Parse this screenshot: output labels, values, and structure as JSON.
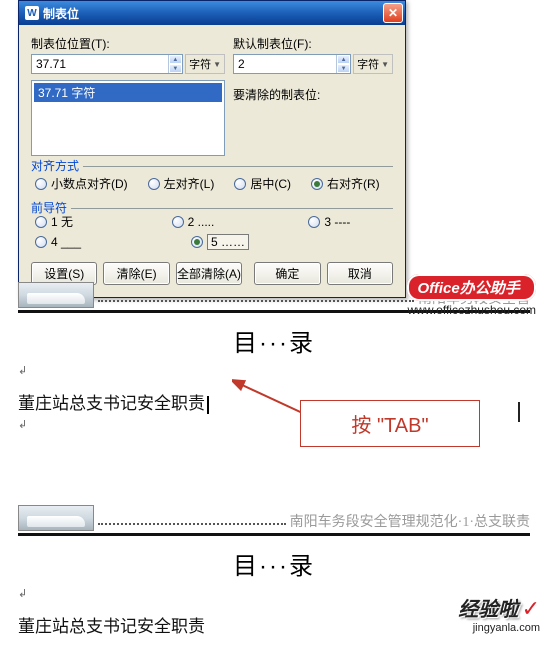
{
  "dialog": {
    "title": "制表位",
    "tab_pos_label": "制表位位置(T):",
    "tab_pos_value": "37.71",
    "unit_label": "字符",
    "default_label": "默认制表位(F):",
    "default_value": "2",
    "clear_label": "要清除的制表位:",
    "list_item": "37.71 字符",
    "align": {
      "group": "对齐方式",
      "decimal": "小数点对齐(D)",
      "left": "左对齐(L)",
      "center": "居中(C)",
      "right": "右对齐(R)",
      "selected": "right"
    },
    "leader": {
      "group": "前导符",
      "r1": "1 无",
      "r2": "2 .....",
      "r3": "3 ----",
      "r4": "4 ___",
      "r5": "5 ……",
      "selected_row1": "none",
      "selected_row2": "r5"
    },
    "buttons": {
      "set": "设置(S)",
      "clear": "清除(E)",
      "clear_all": "全部清除(A)",
      "ok": "确定",
      "cancel": "取消"
    }
  },
  "doc": {
    "img_tail_text": "南阳车务段安全管",
    "img_tail_text2": "南阳车务段安全管理规范化·1·总支联责",
    "headline": "目···录",
    "para_symbol": "↲",
    "sub_text": "董庄站总支书记安全职责",
    "callout_text": "按 \"TAB\""
  },
  "branding": {
    "badge": "Office办公助手",
    "badge_url": "www.officezhushou.com",
    "footer": "经验啦",
    "footer_url": "jingyanla.com"
  }
}
